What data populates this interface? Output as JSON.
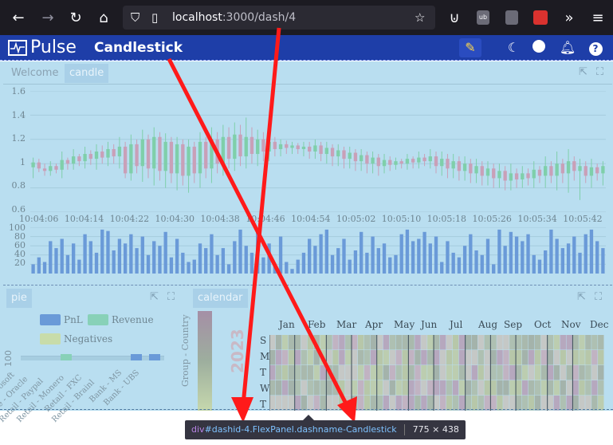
{
  "browser": {
    "url_host": "localhost",
    "url_path": ":3000/dash/4",
    "icons": [
      "back-icon",
      "forward-icon",
      "reload-icon",
      "home-icon",
      "shield-icon",
      "page-icon",
      "bookmark-star-icon",
      "pocket-icon",
      "ublock-icon",
      "privacy-icon",
      "extension-icon",
      "more-tools-icon",
      "menu-icon"
    ]
  },
  "app": {
    "logo_text": "Pulse",
    "dashboard_title": "Candlestick",
    "header_icons": [
      "edit-pencil-icon",
      "dark-mode-moon-icon",
      "user-icon",
      "notification-bell-icon",
      "help-icon"
    ]
  },
  "top_panel": {
    "tabs": [
      "Welcome",
      "candle"
    ],
    "active_tab": "candle"
  },
  "pie_panel": {
    "tab": "pie",
    "legend": [
      "PnL",
      "Revenue",
      "Negatives"
    ],
    "legend_colors": [
      "#6a9ad8",
      "#88d1b8",
      "#c8dcaa"
    ],
    "ytick": "100",
    "categories": [
      "Microsoft",
      "Corporate - Oracle",
      "Retail - Paypal",
      "Retail - Monero",
      "Retail - FXC",
      "Retail - Brainl",
      "Bank - MS",
      "Bank - UBS"
    ]
  },
  "calendar_panel": {
    "tab": "calendar",
    "side_label": "Group - Country",
    "year": "2023",
    "months": [
      "Jan",
      "Feb",
      "Mar",
      "Apr",
      "May",
      "Jun",
      "Jul",
      "Aug",
      "Sep",
      "Oct",
      "Nov",
      "Dec"
    ],
    "days": [
      "S",
      "M",
      "T",
      "W",
      "T"
    ]
  },
  "chart_data": {
    "type": "candlestick",
    "title": "",
    "y_ticks": [
      "1.6",
      "1.4",
      "1.2",
      "1",
      "0.8",
      "0.6"
    ],
    "ylim": [
      0.6,
      1.6
    ],
    "x_ticks": [
      "10:04:06",
      "10:04:14",
      "10:04:22",
      "10:04:30",
      "10:04:38",
      "10:04:46",
      "10:04:54",
      "10:05:02",
      "10:05:10",
      "10:05:18",
      "10:05:26",
      "10:05:34",
      "10:05:42"
    ],
    "up_color": "#7fcfaa",
    "down_color": "#c9a0b8",
    "candles": [
      [
        0.97,
        1.01,
        0.88,
        1.05
      ],
      [
        1.01,
        0.96,
        0.93,
        1.04
      ],
      [
        0.96,
        0.94,
        0.9,
        1.0
      ],
      [
        0.94,
        0.98,
        0.9,
        1.02
      ],
      [
        0.98,
        0.95,
        0.92,
        1.0
      ],
      [
        0.95,
        1.03,
        0.88,
        1.1
      ],
      [
        1.03,
        1.0,
        0.95,
        1.05
      ],
      [
        1.0,
        1.06,
        0.95,
        1.12
      ],
      [
        1.06,
        1.02,
        0.98,
        1.08
      ],
      [
        1.02,
        1.08,
        0.96,
        1.14
      ],
      [
        1.08,
        1.04,
        0.99,
        1.11
      ],
      [
        1.04,
        1.1,
        0.95,
        1.16
      ],
      [
        1.1,
        1.05,
        1.0,
        1.15
      ],
      [
        1.05,
        1.12,
        0.98,
        1.18
      ],
      [
        1.12,
        1.06,
        1.0,
        1.16
      ],
      [
        1.06,
        1.14,
        0.96,
        1.22
      ],
      [
        1.14,
        0.92,
        0.88,
        1.18
      ],
      [
        0.92,
        1.16,
        0.86,
        1.24
      ],
      [
        1.16,
        0.98,
        0.92,
        1.2
      ],
      [
        0.98,
        1.2,
        0.85,
        1.28
      ],
      [
        1.2,
        0.96,
        0.88,
        1.24
      ],
      [
        0.96,
        1.22,
        0.82,
        1.3
      ],
      [
        1.22,
        0.94,
        0.86,
        1.26
      ],
      [
        0.94,
        1.18,
        0.8,
        1.25
      ],
      [
        1.18,
        0.92,
        0.84,
        1.22
      ],
      [
        0.92,
        1.16,
        0.78,
        1.22
      ],
      [
        1.16,
        0.9,
        0.82,
        1.2
      ],
      [
        0.9,
        1.14,
        0.76,
        1.2
      ],
      [
        1.14,
        0.92,
        0.84,
        1.18
      ],
      [
        0.92,
        1.18,
        0.8,
        1.26
      ],
      [
        1.18,
        0.96,
        0.88,
        1.22
      ],
      [
        0.96,
        1.2,
        0.84,
        1.3
      ],
      [
        1.2,
        1.0,
        0.92,
        1.26
      ],
      [
        1.0,
        1.22,
        0.9,
        1.32
      ],
      [
        1.22,
        1.04,
        0.96,
        1.3
      ],
      [
        1.04,
        1.24,
        0.94,
        1.34
      ],
      [
        1.24,
        1.06,
        0.98,
        1.32
      ],
      [
        1.06,
        1.22,
        0.96,
        1.38
      ],
      [
        1.22,
        1.08,
        1.0,
        1.3
      ],
      [
        1.08,
        1.2,
        0.98,
        1.28
      ],
      [
        1.2,
        1.1,
        1.02,
        1.26
      ],
      [
        1.1,
        1.18,
        1.02,
        1.24
      ],
      [
        1.18,
        1.12,
        1.06,
        1.22
      ],
      [
        1.12,
        1.16,
        1.06,
        1.2
      ],
      [
        1.16,
        1.13,
        1.08,
        1.19
      ],
      [
        1.13,
        1.15,
        1.08,
        1.18
      ],
      [
        1.15,
        1.12,
        1.08,
        1.17
      ],
      [
        1.12,
        1.14,
        1.06,
        1.18
      ],
      [
        1.14,
        1.1,
        1.04,
        1.18
      ],
      [
        1.1,
        1.15,
        1.04,
        1.2
      ],
      [
        1.15,
        1.08,
        1.02,
        1.18
      ],
      [
        1.08,
        1.13,
        1.0,
        1.18
      ],
      [
        1.13,
        1.06,
        0.98,
        1.16
      ],
      [
        1.06,
        1.11,
        0.98,
        1.16
      ],
      [
        1.11,
        1.04,
        0.96,
        1.14
      ],
      [
        1.04,
        1.09,
        0.96,
        1.14
      ],
      [
        1.09,
        1.02,
        0.94,
        1.12
      ],
      [
        1.02,
        1.07,
        0.94,
        1.12
      ],
      [
        1.07,
        1.0,
        0.92,
        1.1
      ],
      [
        1.0,
        1.05,
        0.92,
        1.1
      ],
      [
        1.05,
        0.98,
        0.9,
        1.08
      ],
      [
        0.98,
        1.03,
        0.92,
        1.08
      ],
      [
        1.03,
        0.99,
        0.94,
        1.06
      ],
      [
        0.99,
        1.02,
        0.95,
        1.05
      ],
      [
        1.02,
        1.0,
        0.96,
        1.04
      ],
      [
        1.0,
        1.04,
        0.95,
        1.08
      ],
      [
        1.04,
        1.01,
        0.96,
        1.06
      ],
      [
        1.01,
        1.05,
        0.96,
        1.1
      ],
      [
        1.05,
        1.02,
        0.98,
        1.08
      ],
      [
        1.02,
        1.06,
        0.96,
        1.12
      ],
      [
        1.06,
        0.98,
        0.92,
        1.1
      ],
      [
        0.98,
        1.04,
        0.9,
        1.1
      ],
      [
        1.04,
        0.96,
        0.88,
        1.08
      ],
      [
        0.96,
        1.02,
        0.88,
        1.08
      ],
      [
        1.02,
        0.94,
        0.86,
        1.06
      ],
      [
        0.94,
        1.0,
        0.86,
        1.06
      ],
      [
        1.0,
        0.92,
        0.84,
        1.04
      ],
      [
        0.92,
        0.98,
        0.84,
        1.04
      ],
      [
        0.98,
        0.9,
        0.82,
        1.02
      ],
      [
        0.9,
        0.96,
        0.82,
        1.02
      ],
      [
        0.96,
        0.88,
        0.8,
        1.0
      ],
      [
        0.88,
        0.94,
        0.8,
        1.0
      ],
      [
        0.94,
        0.86,
        0.78,
        0.98
      ],
      [
        0.86,
        0.92,
        0.78,
        1.0
      ],
      [
        0.92,
        0.87,
        0.8,
        0.96
      ],
      [
        0.87,
        0.92,
        0.8,
        0.98
      ],
      [
        0.92,
        0.88,
        0.82,
        0.96
      ],
      [
        0.88,
        0.95,
        0.8,
        1.02
      ],
      [
        0.95,
        0.9,
        0.84,
        0.98
      ],
      [
        0.9,
        0.98,
        0.8,
        1.06
      ],
      [
        0.98,
        0.9,
        0.84,
        1.02
      ],
      [
        0.9,
        1.0,
        0.78,
        1.1
      ],
      [
        1.0,
        0.92,
        0.84,
        1.04
      ],
      [
        0.92,
        1.02,
        0.76,
        1.12
      ],
      [
        1.02,
        0.94,
        0.86,
        1.06
      ],
      [
        0.94,
        0.98,
        0.7,
        1.04
      ],
      [
        0.98,
        0.9,
        0.84,
        1.02
      ],
      [
        0.9,
        0.97,
        0.8,
        1.04
      ],
      [
        0.97,
        0.92,
        0.86,
        1.0
      ],
      [
        0.92,
        0.98,
        0.82,
        1.02
      ]
    ],
    "volume_y_ticks": [
      "100",
      "80",
      "60",
      "40",
      "20"
    ],
    "volume": [
      20,
      35,
      25,
      70,
      55,
      75,
      40,
      65,
      30,
      85,
      70,
      45,
      95,
      92,
      50,
      75,
      65,
      85,
      55,
      80,
      40,
      70,
      60,
      90,
      35,
      75,
      45,
      25,
      30,
      65,
      55,
      85,
      40,
      55,
      20,
      70,
      95,
      60,
      45,
      90,
      35,
      65,
      20,
      80,
      25,
      10,
      30,
      45,
      75,
      60,
      85,
      95,
      40,
      55,
      75,
      30,
      50,
      90,
      45,
      80,
      55,
      65,
      35,
      40,
      85,
      95,
      70,
      75,
      90,
      65,
      80,
      25,
      70,
      45,
      35,
      60,
      85,
      50,
      40,
      75,
      20,
      95,
      60,
      90,
      80,
      70,
      85,
      40,
      30,
      50,
      95,
      75,
      55,
      65,
      80,
      45,
      85,
      95,
      70,
      55
    ]
  },
  "inspector_tooltip": {
    "tag": "div",
    "id": "#dashid-4",
    "classes": ".FlexPanel.dashname-Candlestick",
    "size": "775 × 438"
  }
}
